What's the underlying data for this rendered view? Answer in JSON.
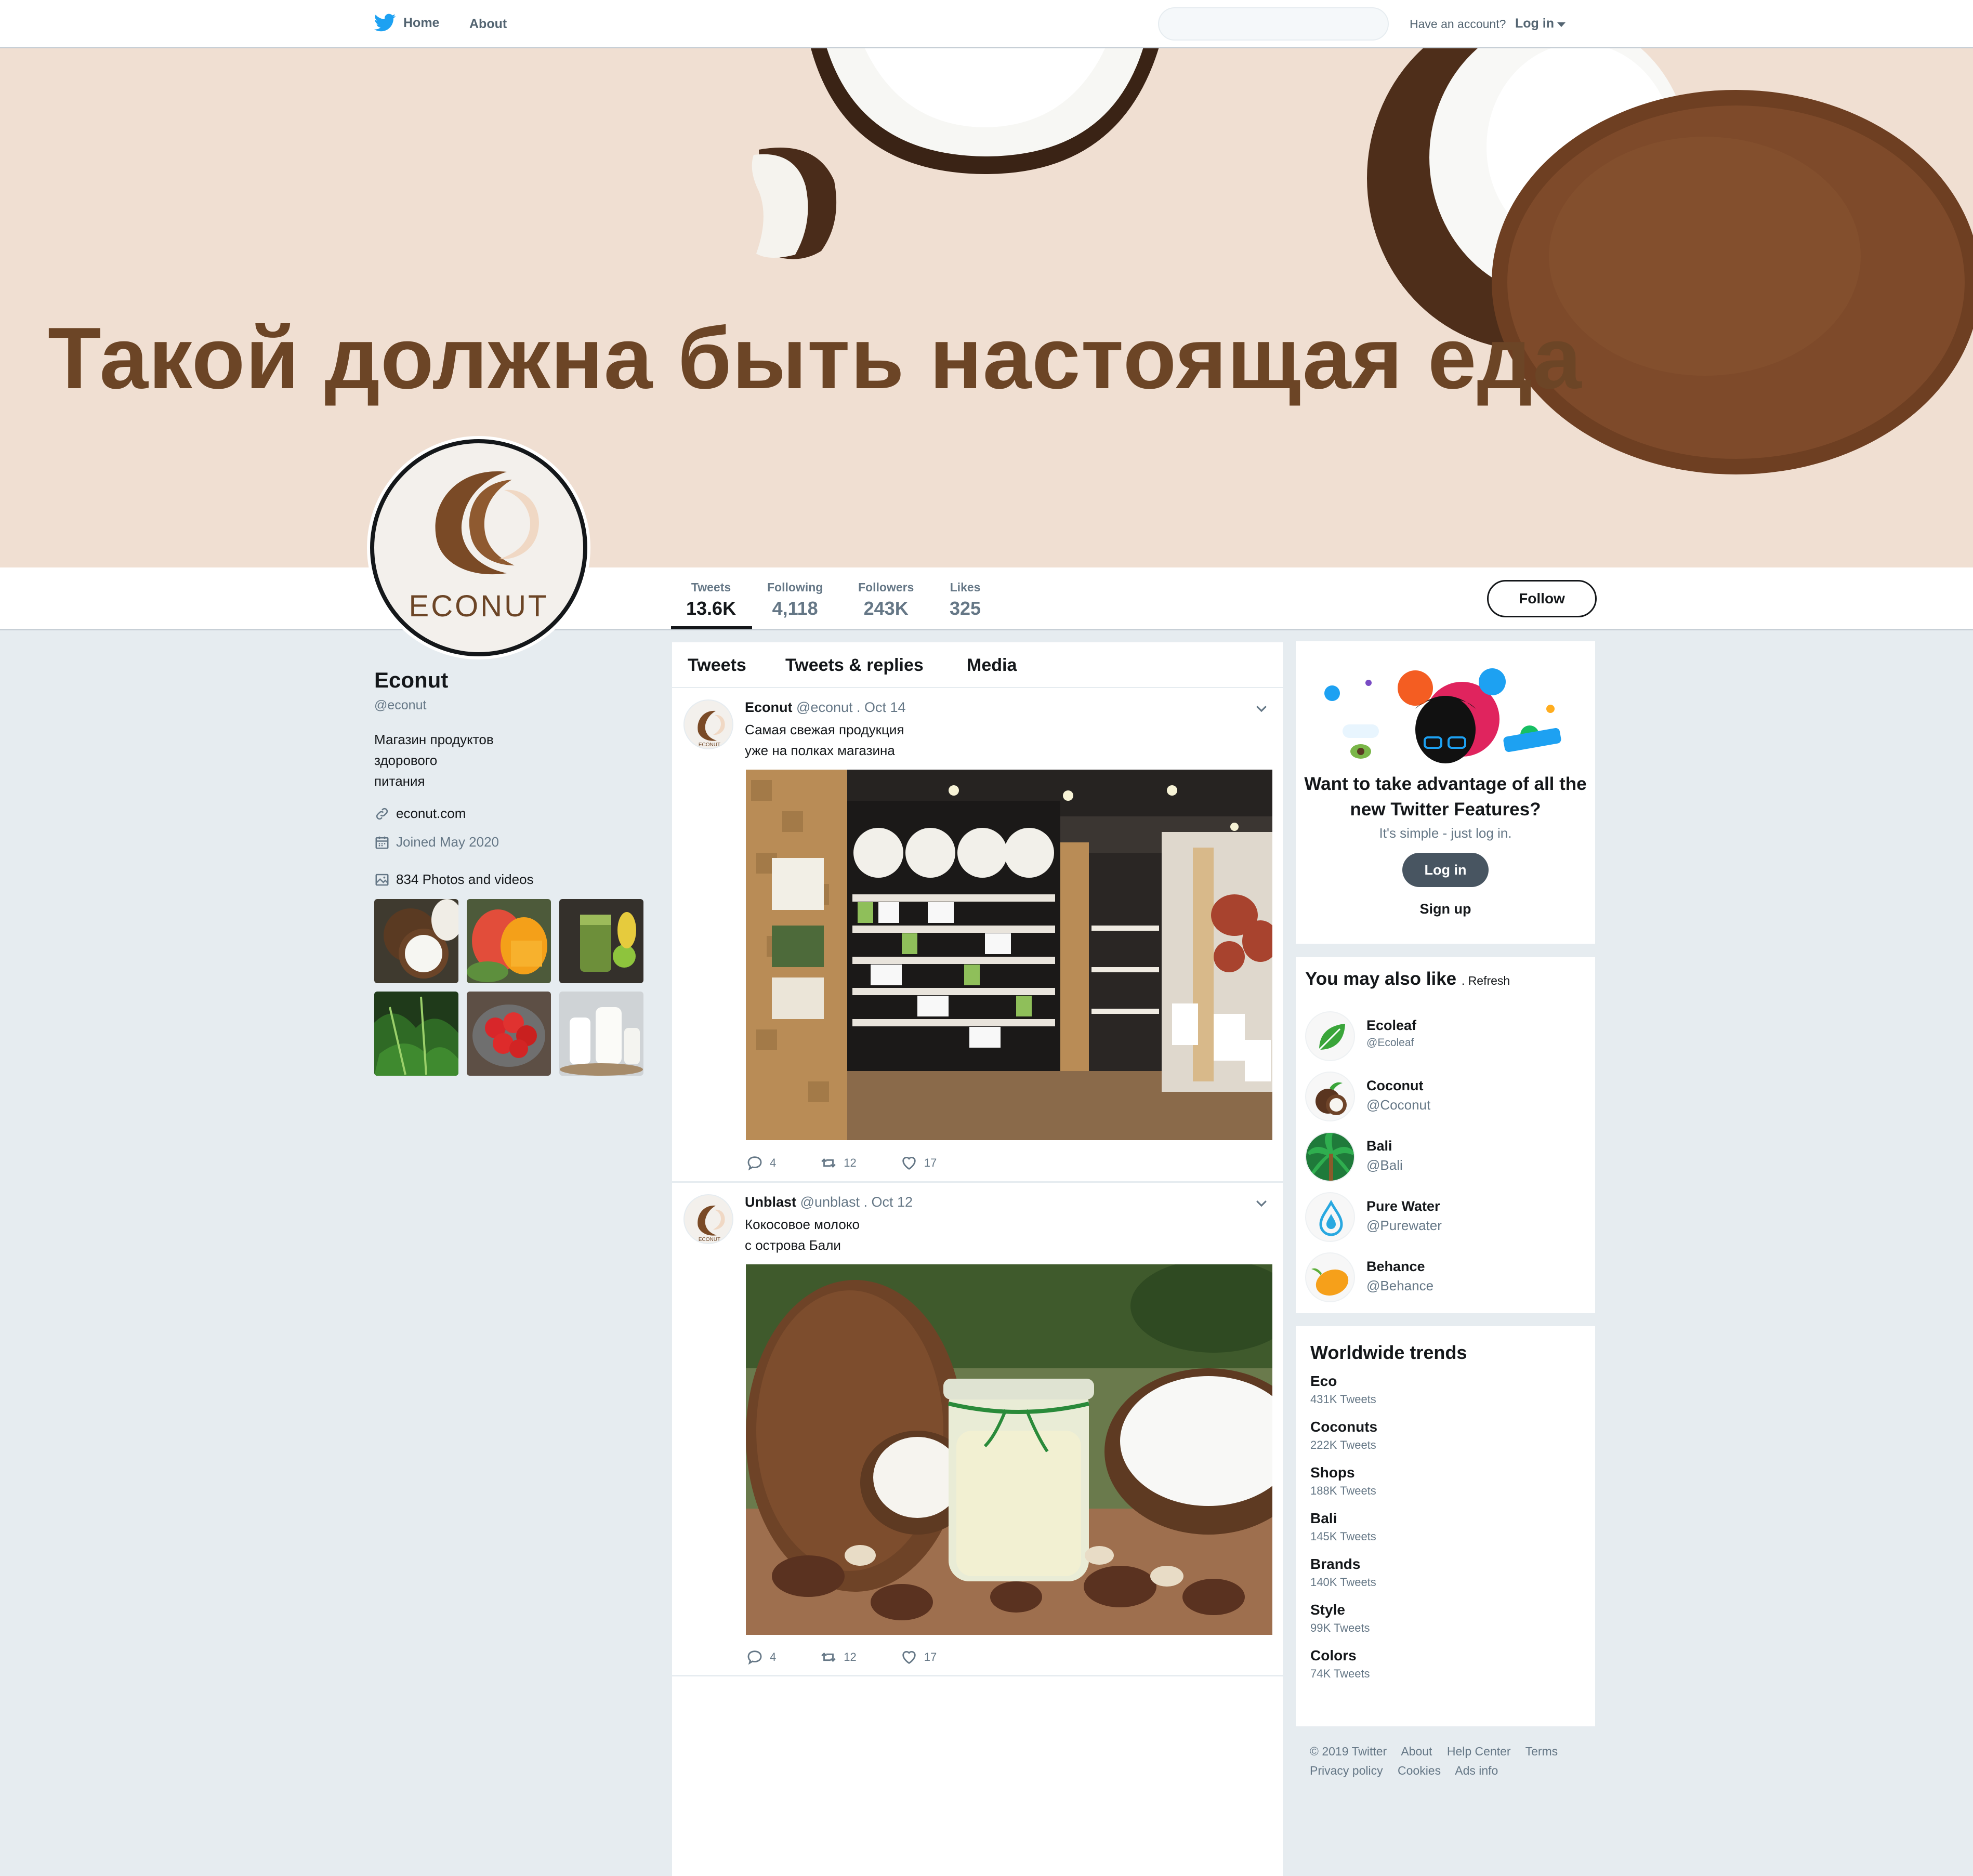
{
  "nav": {
    "home_label": "Home",
    "about_label": "About",
    "search_placeholder": "",
    "account_prompt": "Have an account?",
    "login_label": "Log in"
  },
  "banner": {
    "headline": "Такой должна быть настоящая еда"
  },
  "avatar": {
    "logo_text": "ECONUT"
  },
  "stats": {
    "tweets": {
      "label": "Tweets",
      "value": "13.6K"
    },
    "following": {
      "label": "Following",
      "value": "4,118"
    },
    "followers": {
      "label": "Followers",
      "value": "243K"
    },
    "likes": {
      "label": "Likes",
      "value": "325"
    },
    "follow_label": "Follow"
  },
  "profile": {
    "name": "Econut",
    "handle": "@econut",
    "bio": "Магазин продуктов\nздорового\nпитания",
    "website": "econut.com",
    "joined": "Joined May 2020",
    "media_count": "834 Photos and videos",
    "photos": [
      "coconut-photo",
      "mango-photo",
      "smoothie-photo",
      "greens-photo",
      "strawberries-photo",
      "milk-photo"
    ]
  },
  "tabs": [
    "Tweets",
    "Tweets & replies",
    "Media"
  ],
  "tweets": [
    {
      "name": "Econut",
      "handle": "@econut",
      "date": ". Oct 14",
      "text": "Самая свежая продукция\nуже на полках магазина",
      "image": "store-interior-photo",
      "replies": "4",
      "retweets": "12",
      "likes": "17"
    },
    {
      "name": "Unblast",
      "handle": "@unblast",
      "date": ". Oct 12",
      "text": "Кокосовое молоко\nс острова Бали",
      "image": "coconut-milk-photo",
      "replies": "4",
      "retweets": "12",
      "likes": "17"
    }
  ],
  "promo": {
    "title": "Want to take advantage of all the new Twitter Features?",
    "subtitle": "It's simple - just log in.",
    "login_label": "Log in",
    "signup_label": "Sign up"
  },
  "who_to_follow": {
    "title": "You may also like",
    "refresh_label": ". Refresh",
    "accounts": [
      {
        "name": "Ecoleaf",
        "handle": "@Ecoleaf",
        "icon": "leaf-icon"
      },
      {
        "name": "Coconut",
        "handle": "@Coconut",
        "icon": "coconut-icon"
      },
      {
        "name": "Bali",
        "handle": "@Bali",
        "icon": "palm-icon"
      },
      {
        "name": "Pure Water",
        "handle": "@Purewater",
        "icon": "water-drop-icon"
      },
      {
        "name": "Behance",
        "handle": "@Behance",
        "icon": "mango-icon"
      }
    ]
  },
  "trends": {
    "title": "Worldwide trends",
    "items": [
      {
        "name": "Eco",
        "count": "431K Tweets"
      },
      {
        "name": "Coconuts",
        "count": "222K Tweets"
      },
      {
        "name": "Shops",
        "count": "188K Tweets"
      },
      {
        "name": "Bali",
        "count": "145K Tweets"
      },
      {
        "name": "Brands",
        "count": "140K Tweets"
      },
      {
        "name": "Style",
        "count": "99K Tweets"
      },
      {
        "name": "Colors",
        "count": "74K Tweets"
      }
    ]
  },
  "footer": {
    "links_row1": [
      "© 2019 Twitter",
      "About",
      "Help Center",
      "Terms"
    ],
    "links_row2": [
      "Privacy policy",
      "Cookies",
      "Ads info"
    ]
  },
  "colors": {
    "banner_bg": "#f0dfd2",
    "brand_brown": "#6c4526",
    "page_bg": "#e6ecf0",
    "twitter_blue": "#1da1f2"
  }
}
